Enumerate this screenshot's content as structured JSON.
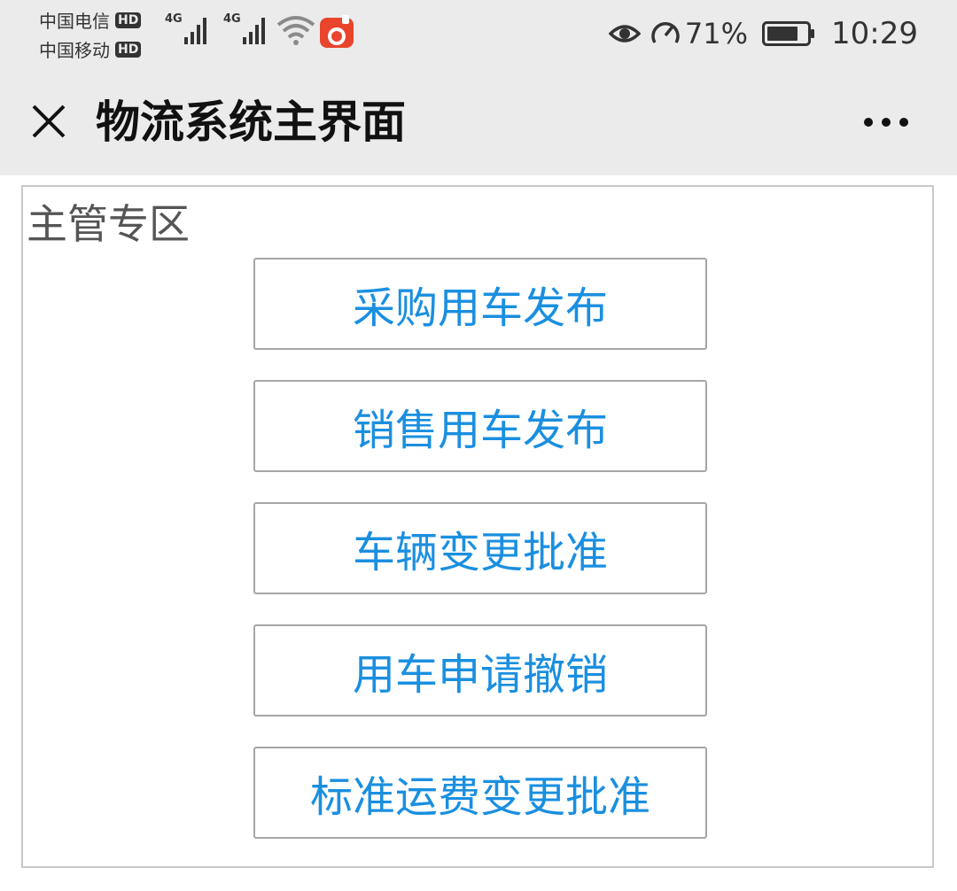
{
  "status_bar": {
    "carriers": [
      {
        "name": "中国电信",
        "badge": "HD",
        "network": "4G"
      },
      {
        "name": "中国移动",
        "badge": "HD",
        "network": "4G"
      }
    ],
    "battery_percent": "71%",
    "time": "10:29",
    "icons": [
      "signal-icon",
      "wifi-icon",
      "app-notification-icon",
      "eye-icon",
      "speed-icon",
      "battery-icon"
    ]
  },
  "title_bar": {
    "title": "物流系统主界面",
    "close_icon": "close-icon",
    "more_icon": "more-icon"
  },
  "section": {
    "title": "主管专区",
    "buttons": [
      {
        "label": "采购用车发布"
      },
      {
        "label": "销售用车发布"
      },
      {
        "label": "车辆变更批准"
      },
      {
        "label": "用车申请撤销"
      },
      {
        "label": "标准运费变更批准"
      }
    ]
  },
  "colors": {
    "header_bg": "#ebebeb",
    "button_text": "#1a8fe0",
    "button_border": "#a6a6a6",
    "panel_border": "#c8c8c8"
  }
}
